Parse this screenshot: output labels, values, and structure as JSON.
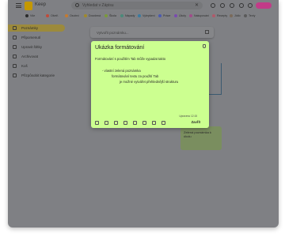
{
  "app": {
    "name": "Keep"
  },
  "search": {
    "placeholder": "Vyhledat v Zápisu"
  },
  "labels": [
    {
      "text": "Vše",
      "color": "#2a2a2a"
    },
    {
      "text": "Ošetř.",
      "color": "#c04a3a"
    },
    {
      "text": "Osobní",
      "color": "#c57a2f"
    },
    {
      "text": "Dovolená",
      "color": "#a08a2a"
    },
    {
      "text": "Škola",
      "color": "#7a9a3a"
    },
    {
      "text": "Nápady",
      "color": "#4a8a7a"
    },
    {
      "text": "Vylepšení",
      "color": "#3a7aa0"
    },
    {
      "text": "Práce",
      "color": "#4a5ab0"
    },
    {
      "text": "Úkoly",
      "color": "#7a4ab0"
    },
    {
      "text": "Nakupování",
      "color": "#a04a8a"
    },
    {
      "text": "Recepty",
      "color": "#b05a6a"
    },
    {
      "text": "Jídlo",
      "color": "#7a6a5a"
    },
    {
      "text": "Texty",
      "color": "#5a5a5a"
    }
  ],
  "sidebar": {
    "items": [
      {
        "label": "Poznámky",
        "active": true
      },
      {
        "label": "Připomenutí",
        "active": false
      },
      {
        "label": "Upravit štítky",
        "active": false
      },
      {
        "label": "Archivovat",
        "active": false
      },
      {
        "label": "Koš",
        "active": false
      },
      {
        "label": "Přizpůsobit kategorie",
        "active": false
      }
    ]
  },
  "new_note": {
    "placeholder": "Vytvořit poznámku..."
  },
  "modal": {
    "title": "Ukázka formátování",
    "line1": "Formátování s použitím Tab může vypadat takto",
    "line2": "- vlastní zelená poznámka",
    "line3": "formátování textu za použití Tab",
    "line4": "je možné vytvářet přehlednější strukturu",
    "edited": "Upraveno 12:15",
    "close": "Zavřít"
  },
  "background_note": {
    "text": "Zelená poznámka k úkolu"
  },
  "colors": {
    "modal_bg": "#ccff90",
    "accent": "#c23b88",
    "logo": "#c49800"
  }
}
